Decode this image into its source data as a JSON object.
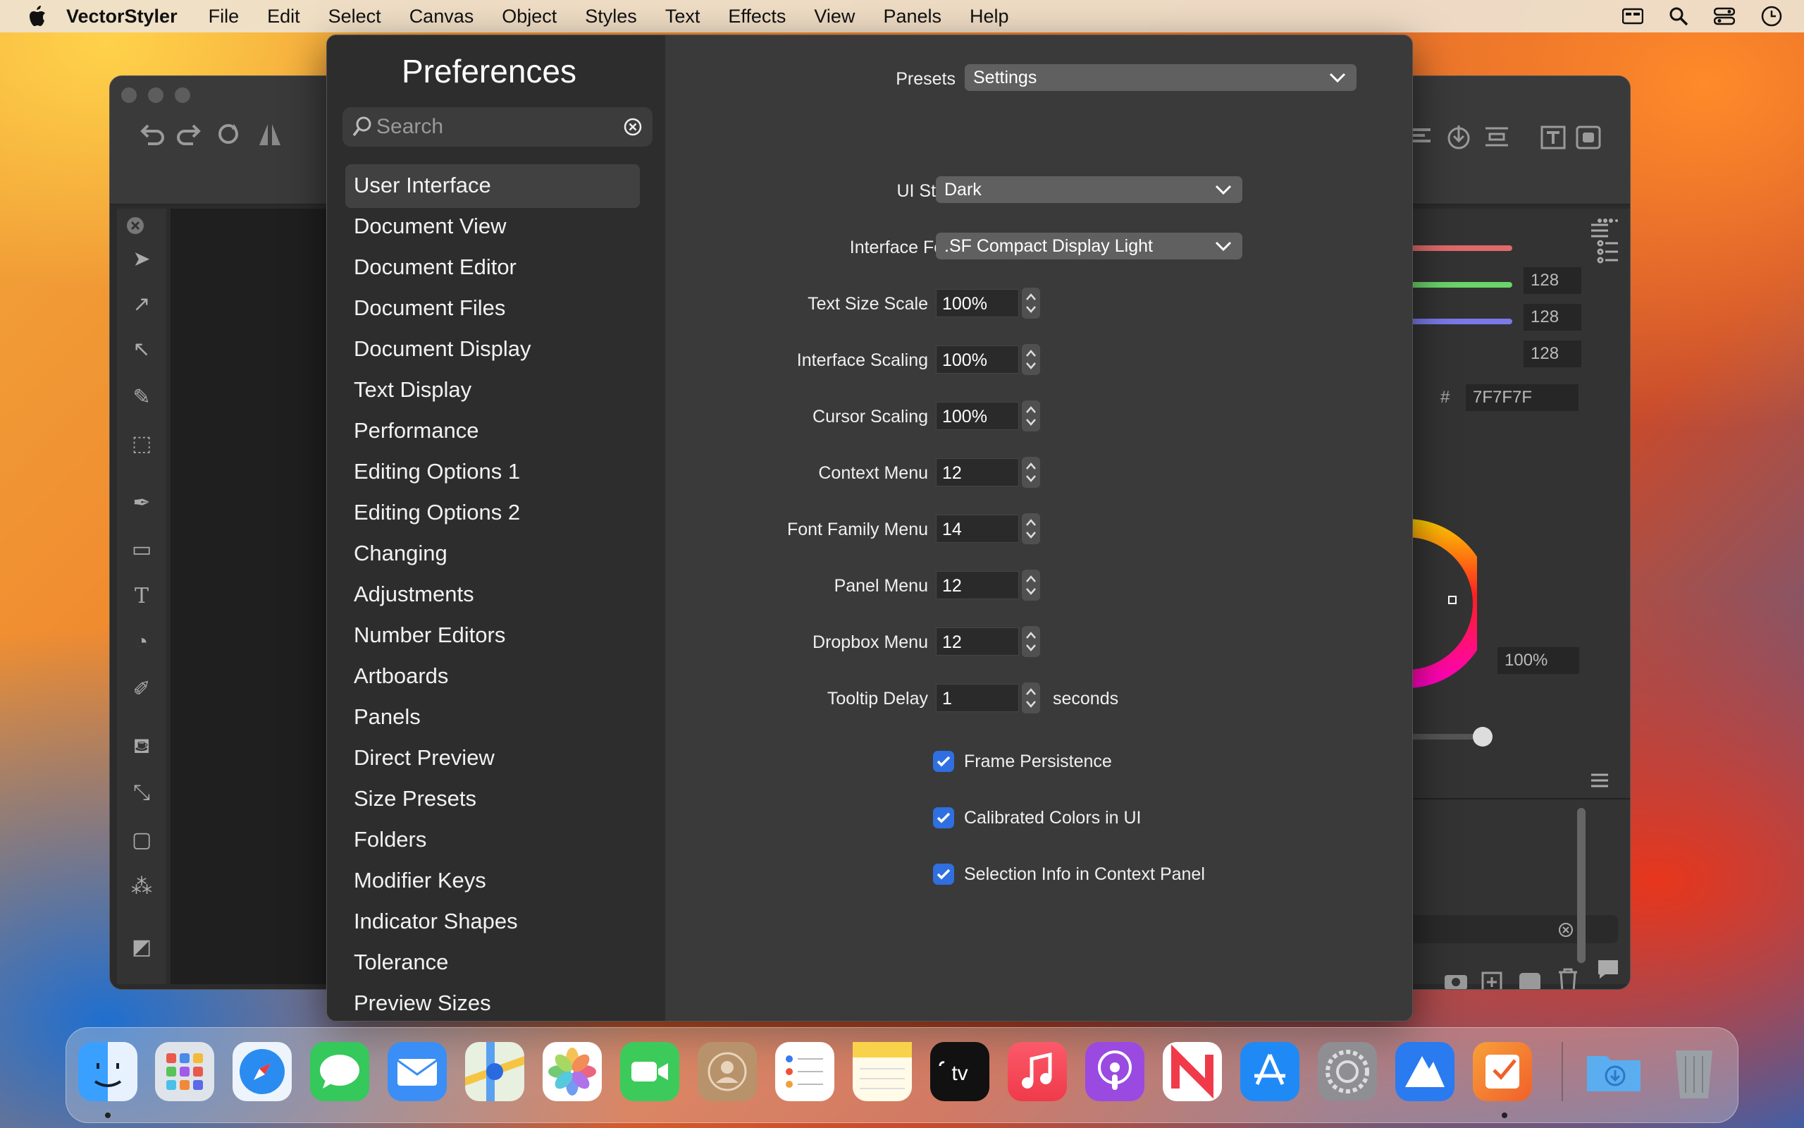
{
  "menubar": {
    "app": "VectorStyler",
    "items": [
      "File",
      "Edit",
      "Select",
      "Canvas",
      "Object",
      "Styles",
      "Text",
      "Effects",
      "View",
      "Panels",
      "Help"
    ]
  },
  "prefs": {
    "title": "Preferences",
    "search_placeholder": "Search",
    "sidebar": [
      "User Interface",
      "Document View",
      "Document Editor",
      "Document Files",
      "Document Display",
      "Text Display",
      "Performance",
      "Editing Options 1",
      "Editing Options 2",
      "Changing",
      "Adjustments",
      "Number Editors",
      "Artboards",
      "Panels",
      "Direct Preview",
      "Size Presets",
      "Folders",
      "Modifier Keys",
      "Indicator Shapes",
      "Tolerance",
      "Preview Sizes"
    ],
    "selected": "User Interface",
    "presets": {
      "label": "Presets",
      "value": "Settings"
    },
    "ui_style": {
      "label": "UI Style",
      "value": "Dark"
    },
    "interface_font": {
      "label": "Interface Font",
      "value": ".SF Compact Display Light"
    },
    "steppers": [
      {
        "label": "Text Size Scale",
        "value": "100%"
      },
      {
        "label": "Interface Scaling",
        "value": "100%"
      },
      {
        "label": "Cursor Scaling",
        "value": "100%"
      },
      {
        "label": "Context Menu",
        "value": "12"
      },
      {
        "label": "Font Family Menu",
        "value": "14"
      },
      {
        "label": "Panel Menu",
        "value": "12"
      },
      {
        "label": "Dropbox Menu",
        "value": "12"
      },
      {
        "label": "Tooltip Delay",
        "value": "1"
      }
    ],
    "tooltip_unit": "seconds",
    "checkboxes": [
      {
        "label": "Frame Persistence",
        "checked": true
      },
      {
        "label": "Calibrated Colors in UI",
        "checked": true
      },
      {
        "label": "Selection Info in Context Panel",
        "checked": true
      }
    ]
  },
  "bgpanel": {
    "r": "128",
    "g": "128",
    "b": "128",
    "hash": "#",
    "hex": "7F7F7F",
    "opacity": "100%"
  },
  "colors": {
    "accent": "#2f6fe0",
    "dialog": "#3a3a3a",
    "sidebar": "#2d2d2d"
  },
  "dock": [
    "finder-icon",
    "launchpad-icon",
    "safari-icon",
    "messages-icon",
    "mail-icon",
    "maps-icon",
    "photos-icon",
    "facetime-icon",
    "contacts-icon",
    "reminders-icon",
    "notes-icon",
    "tv-icon",
    "music-icon",
    "podcasts-icon",
    "news-icon",
    "app-store-icon",
    "system-settings-icon",
    "altitude-icon",
    "vectorstyler-icon",
    "downloads-folder-icon",
    "trash-icon"
  ]
}
